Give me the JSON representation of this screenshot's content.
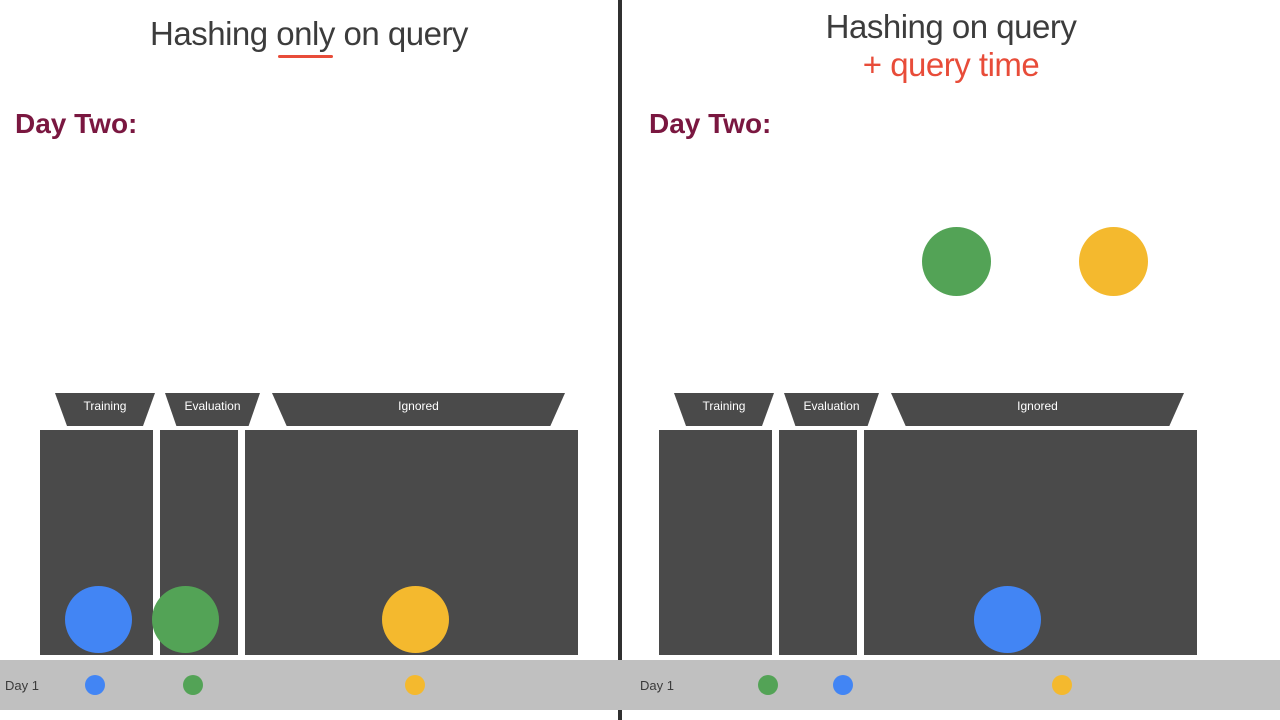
{
  "left": {
    "title_a": "Hashing ",
    "title_b": "only",
    "title_c": " on query",
    "day": "Day Two:",
    "buckets": {
      "train": "Training",
      "eval": "Evaluation",
      "ignored": "Ignored"
    }
  },
  "right": {
    "title1": "Hashing on query",
    "title2": "+ query time",
    "day": "Day Two:",
    "buckets": {
      "train": "Training",
      "eval": "Evaluation",
      "ignored": "Ignored"
    }
  },
  "colors": {
    "blue": "#4285f4",
    "green": "#53a356",
    "yellow": "#f4b92e",
    "bucket": "#4a4a4a"
  },
  "day1": {
    "label": "Day 1"
  },
  "chart_data": {
    "type": "diagram",
    "panels": [
      {
        "title": "Hashing only on query",
        "day": "Day Two",
        "buckets": [
          "Training",
          "Evaluation",
          "Ignored"
        ],
        "placements": [
          {
            "item": "blue",
            "bucket": "Training"
          },
          {
            "item": "green",
            "bucket": "Evaluation"
          },
          {
            "item": "yellow",
            "bucket": "Ignored"
          }
        ],
        "floating": [],
        "day1_order": [
          "blue",
          "green",
          "yellow"
        ]
      },
      {
        "title": "Hashing on query + query time",
        "day": "Day Two",
        "buckets": [
          "Training",
          "Evaluation",
          "Ignored"
        ],
        "placements": [
          {
            "item": "blue",
            "bucket": "Ignored"
          }
        ],
        "floating": [
          "green",
          "yellow"
        ],
        "day1_order": [
          "green",
          "blue",
          "yellow"
        ]
      }
    ]
  }
}
